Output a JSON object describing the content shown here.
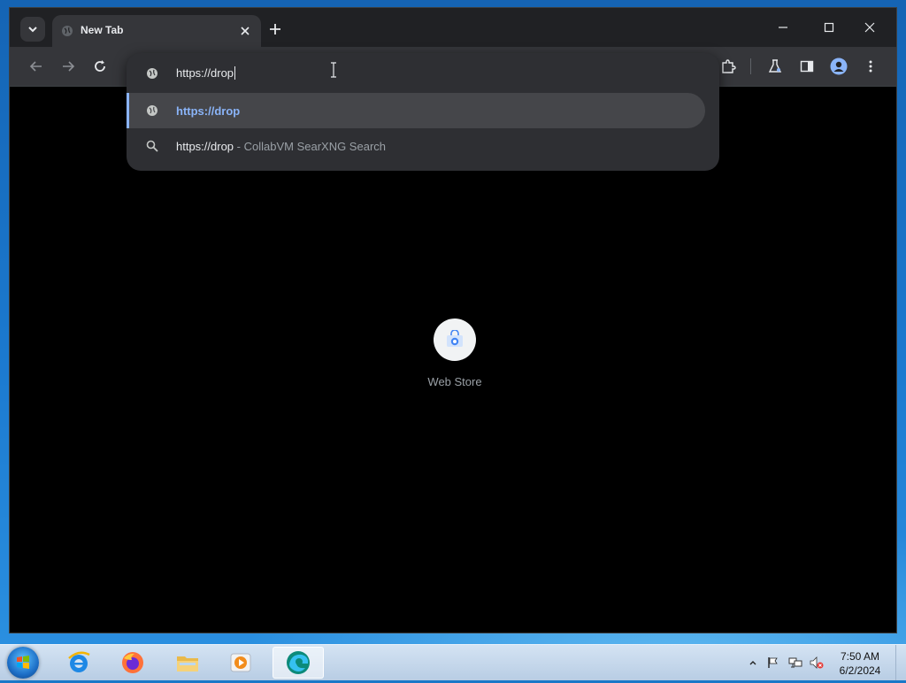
{
  "browser": {
    "tab": {
      "title": "New Tab"
    },
    "omnibox": {
      "value": "https://drop"
    },
    "suggestions": [
      {
        "type": "url",
        "text": "https://drop"
      },
      {
        "type": "search",
        "query": "https://drop",
        "description": " - CollabVM SearXNG Search"
      }
    ],
    "page": {
      "shortcuts": [
        {
          "label": "Web Store",
          "icon": "web-store-icon"
        }
      ]
    }
  },
  "taskbar": {
    "apps": [
      "internet-explorer-icon",
      "firefox-icon",
      "file-explorer-icon",
      "media-player-icon",
      "edge-icon"
    ],
    "clock": {
      "time": "7:50 AM",
      "date": "6/2/2024"
    }
  },
  "colors": {
    "accent": "#8ab4f8",
    "chrome_dark": "#202124",
    "toolbar": "#35363a"
  }
}
